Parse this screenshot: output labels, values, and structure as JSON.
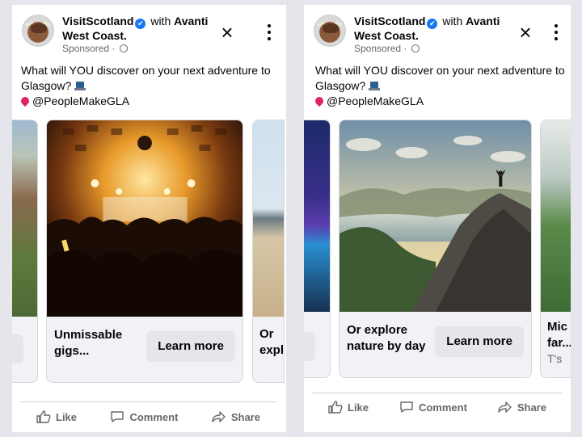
{
  "posts": [
    {
      "page_name": "VisitScotland",
      "verified_mark": "✔",
      "with_text": "with",
      "partner_name": "Avanti West Coast.",
      "sponsored": "Sponsored ·",
      "caption_line1": "What will YOU discover on your next adventure to Glasgow?",
      "caption_line2": "@PeopleMakeGLA",
      "card_main": {
        "title": "Unmissable gigs...",
        "cta": "Learn more"
      },
      "card_next": {
        "title": "Or expl..."
      },
      "actions": {
        "like": "Like",
        "comment": "Comment",
        "share": "Share"
      }
    },
    {
      "page_name": "VisitScotland",
      "verified_mark": "✔",
      "with_text": "with",
      "partner_name": "Avanti West Coast.",
      "sponsored": "Sponsored ·",
      "caption_line1": "What will YOU discover on your next adventure to Glasgow?",
      "caption_line2": "@PeopleMakeGLA",
      "card_main": {
        "title": "Or explore nature by day",
        "cta": "Learn more"
      },
      "card_next": {
        "title": "Mic far...",
        "sub": "T's"
      },
      "actions": {
        "like": "Like",
        "comment": "Comment",
        "share": "Share"
      }
    }
  ],
  "icons": [
    "verified-badge-icon",
    "globe-icon",
    "close-icon",
    "more-icon",
    "laptop-emoji-icon",
    "pin-emoji-icon",
    "like-icon",
    "comment-icon",
    "share-icon"
  ],
  "colors": {
    "verified": "#1877f2",
    "muted": "#65676b",
    "card_footer": "#f0f2f5",
    "button": "#e4e6eb"
  }
}
